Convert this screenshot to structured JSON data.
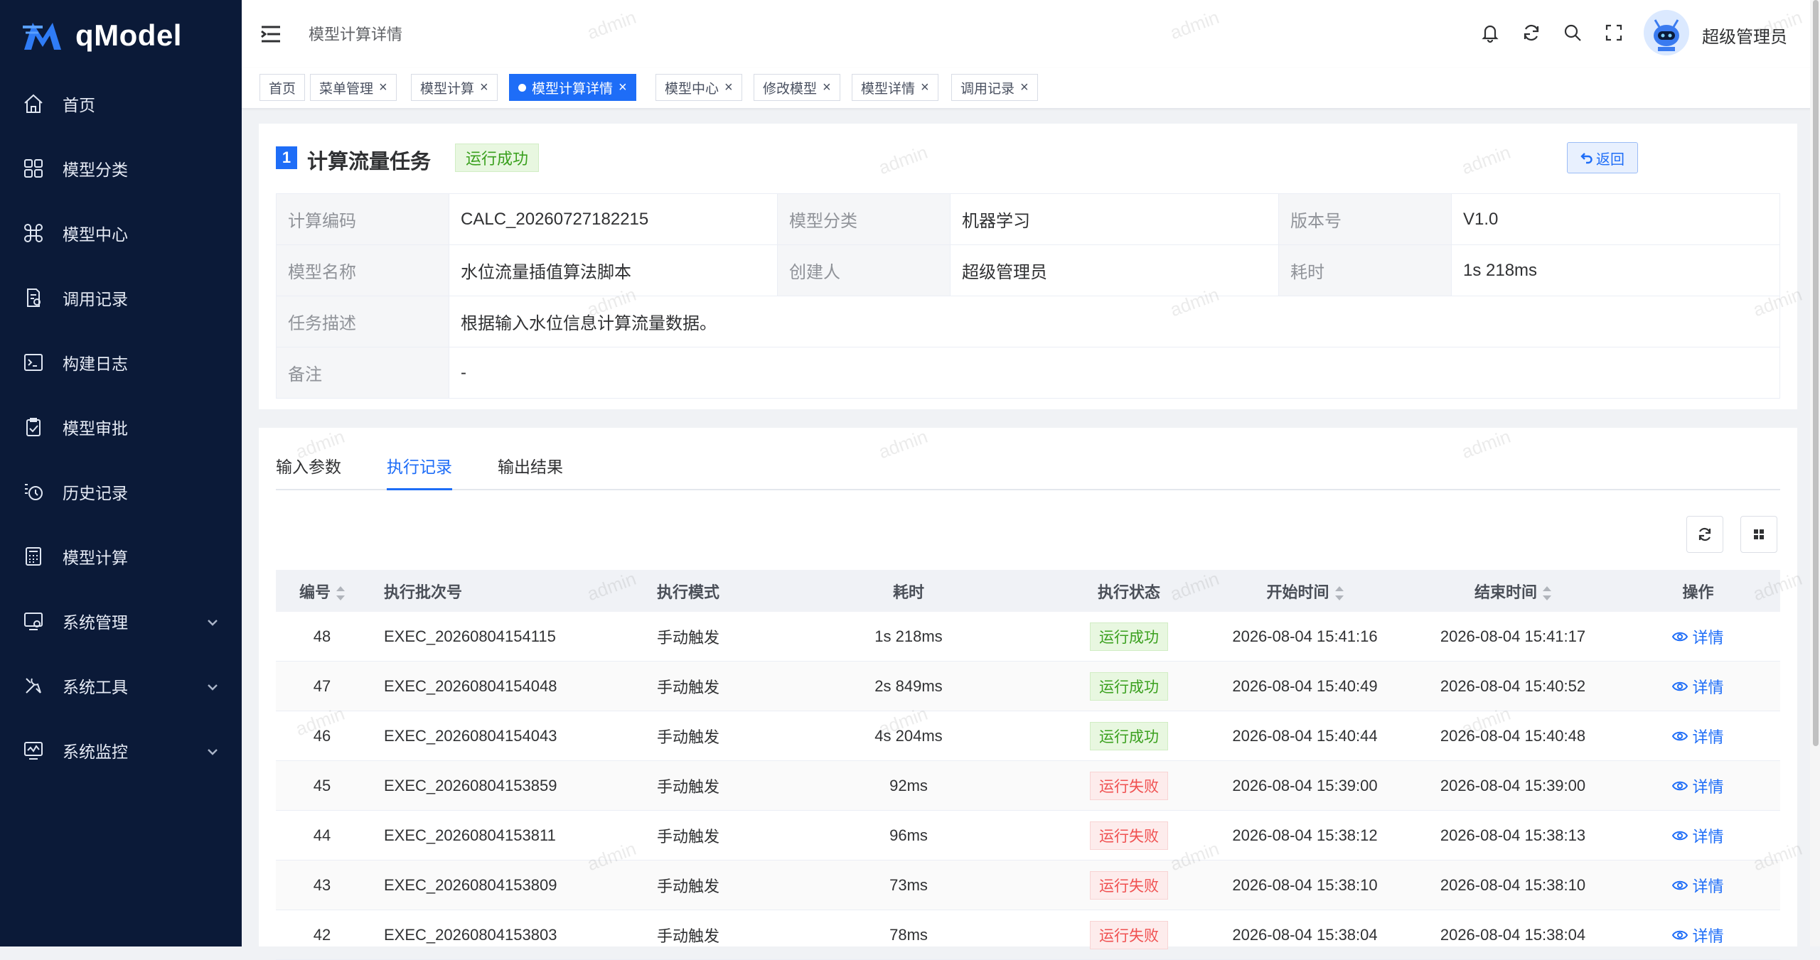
{
  "app": {
    "name": "qModel"
  },
  "sidebar": {
    "items": [
      {
        "label": "首页",
        "icon": "home-icon"
      },
      {
        "label": "模型分类",
        "icon": "grid-icon"
      },
      {
        "label": "模型中心",
        "icon": "command-icon"
      },
      {
        "label": "调用记录",
        "icon": "call-log-icon"
      },
      {
        "label": "构建日志",
        "icon": "terminal-icon"
      },
      {
        "label": "模型审批",
        "icon": "clipboard-check-icon"
      },
      {
        "label": "历史记录",
        "icon": "history-icon"
      },
      {
        "label": "模型计算",
        "icon": "calculator-icon"
      },
      {
        "label": "系统管理",
        "icon": "system-manage-icon",
        "expandable": true
      },
      {
        "label": "系统工具",
        "icon": "tools-icon",
        "expandable": true
      },
      {
        "label": "系统监控",
        "icon": "monitor-icon",
        "expandable": true
      }
    ]
  },
  "header": {
    "title": "模型计算详情",
    "user": "超级管理员"
  },
  "tags": [
    {
      "label": "首页",
      "closable": false
    },
    {
      "label": "菜单管理",
      "closable": true
    },
    {
      "label": "模型计算",
      "closable": true
    },
    {
      "label": "模型计算详情",
      "closable": true,
      "active": true
    },
    {
      "label": "模型中心",
      "closable": true
    },
    {
      "label": "修改模型",
      "closable": true
    },
    {
      "label": "模型详情",
      "closable": true
    },
    {
      "label": "调用记录",
      "closable": true
    }
  ],
  "task": {
    "section_number": "1",
    "title": "计算流量任务",
    "status": "运行成功",
    "back_label": "返回",
    "fields": {
      "code_label": "计算编码",
      "code": "CALC_20260727182215",
      "category_label": "模型分类",
      "category": "机器学习",
      "version_label": "版本号",
      "version": "V1.0",
      "name_label": "模型名称",
      "name": "水位流量插值算法脚本",
      "creator_label": "创建人",
      "creator": "超级管理员",
      "duration_label": "耗时",
      "duration": "1s 218ms",
      "desc_label": "任务描述",
      "desc": "根据输入水位信息计算流量数据。",
      "remark_label": "备注",
      "remark": "-"
    }
  },
  "record_tabs": [
    {
      "label": "输入参数"
    },
    {
      "label": "执行记录",
      "active": true
    },
    {
      "label": "输出结果"
    }
  ],
  "table": {
    "columns": [
      "编号",
      "执行批次号",
      "执行模式",
      "耗时",
      "执行状态",
      "开始时间",
      "结束时间",
      "操作"
    ],
    "detail_label": "详情",
    "rows": [
      {
        "id": "48",
        "batch": "EXEC_20260804154115",
        "mode": "手动触发",
        "duration": "1s 218ms",
        "status": "运行成功",
        "ok": true,
        "start": "2026-08-04 15:41:16",
        "end": "2026-08-04 15:41:17"
      },
      {
        "id": "47",
        "batch": "EXEC_20260804154048",
        "mode": "手动触发",
        "duration": "2s 849ms",
        "status": "运行成功",
        "ok": true,
        "start": "2026-08-04 15:40:49",
        "end": "2026-08-04 15:40:52"
      },
      {
        "id": "46",
        "batch": "EXEC_20260804154043",
        "mode": "手动触发",
        "duration": "4s 204ms",
        "status": "运行成功",
        "ok": true,
        "start": "2026-08-04 15:40:44",
        "end": "2026-08-04 15:40:48"
      },
      {
        "id": "45",
        "batch": "EXEC_20260804153859",
        "mode": "手动触发",
        "duration": "92ms",
        "status": "运行失败",
        "ok": false,
        "start": "2026-08-04 15:39:00",
        "end": "2026-08-04 15:39:00"
      },
      {
        "id": "44",
        "batch": "EXEC_20260804153811",
        "mode": "手动触发",
        "duration": "96ms",
        "status": "运行失败",
        "ok": false,
        "start": "2026-08-04 15:38:12",
        "end": "2026-08-04 15:38:13"
      },
      {
        "id": "43",
        "batch": "EXEC_20260804153809",
        "mode": "手动触发",
        "duration": "73ms",
        "status": "运行失败",
        "ok": false,
        "start": "2026-08-04 15:38:10",
        "end": "2026-08-04 15:38:10"
      },
      {
        "id": "42",
        "batch": "EXEC_20260804153803",
        "mode": "手动触发",
        "duration": "78ms",
        "status": "运行失败",
        "ok": false,
        "start": "2026-08-04 15:38:04",
        "end": "2026-08-04 15:38:04"
      }
    ]
  },
  "watermark": "admin",
  "colors": {
    "primary": "#1e6df7",
    "sidebar_bg": "#0b1a38",
    "success": "#3aa01e",
    "danger": "#f05050"
  }
}
